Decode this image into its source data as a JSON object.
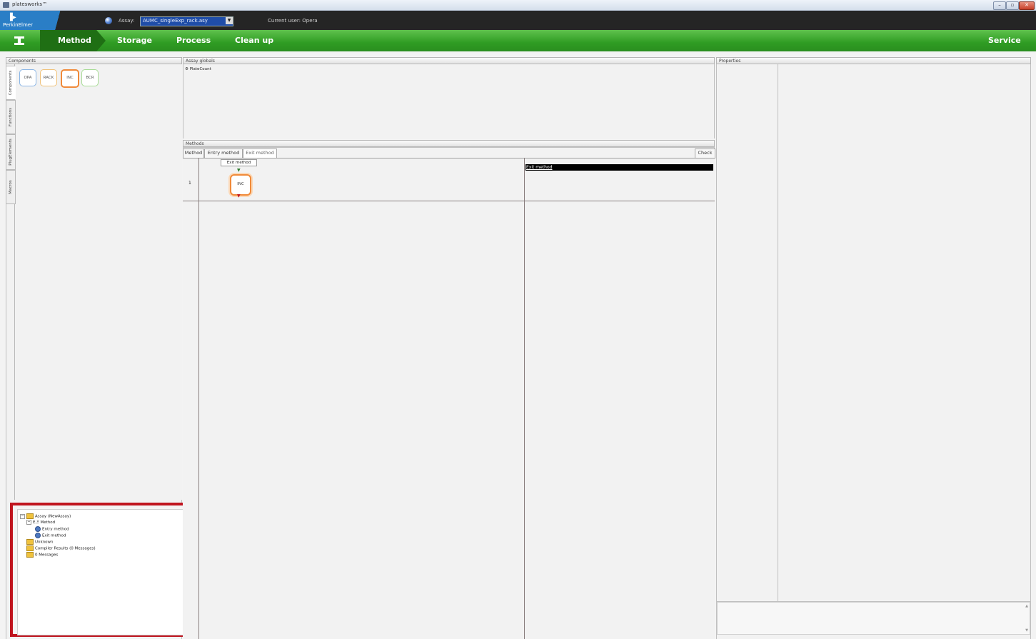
{
  "window": {
    "title": "platesworks™",
    "controls": [
      "–",
      "▫",
      "✕"
    ]
  },
  "header": {
    "brand": "PerkinElmer",
    "assay_label": "Assay:",
    "assay_value": "AUMC_singleExp_rack.asy",
    "current_user": "Current user:  Opera"
  },
  "nav": {
    "items": [
      "Method",
      "Storage",
      "Process",
      "Clean up"
    ],
    "service": "Service"
  },
  "components_panel": {
    "title": "Components",
    "side_tabs": [
      "Components",
      "Functions",
      "PlugElements",
      "Macros"
    ],
    "items": [
      "OPA",
      "RACK",
      "INC",
      "BCR"
    ]
  },
  "assay_globals": {
    "title": "Assay globals",
    "items": [
      "PlateCount"
    ]
  },
  "methods": {
    "title": "Methods",
    "tabs": [
      "Method",
      "Entry method",
      "Exit method"
    ],
    "check_label": "Check",
    "step_label": "Exit method",
    "row_number": "1",
    "node_label": "INC",
    "selected_item": "Exit method"
  },
  "properties": {
    "title": "Properties"
  },
  "tree": {
    "nodes": [
      {
        "label": "Assay (NewAssay)",
        "level": 0,
        "icon": "folder-icon"
      },
      {
        "label": "Method",
        "level": 1,
        "icon": "method-icon"
      },
      {
        "label": "Entry method",
        "level": 2,
        "icon": "method-icon"
      },
      {
        "label": "Exit method",
        "level": 2,
        "icon": "method-icon"
      },
      {
        "label": "Unknown",
        "level": 1,
        "icon": "folder-icon"
      },
      {
        "label": "Compiler Results (0 Messages)",
        "level": 1,
        "icon": "folder-icon"
      },
      {
        "label": "0 Messages",
        "level": 1,
        "icon": "folder-icon"
      }
    ]
  },
  "colors": {
    "nav_green": "#2f9c23",
    "nav_active": "#1f6f14",
    "brand_blue": "#2a7ec6",
    "highlight_red": "#c0151f",
    "inc_orange": "#f08a3a"
  }
}
